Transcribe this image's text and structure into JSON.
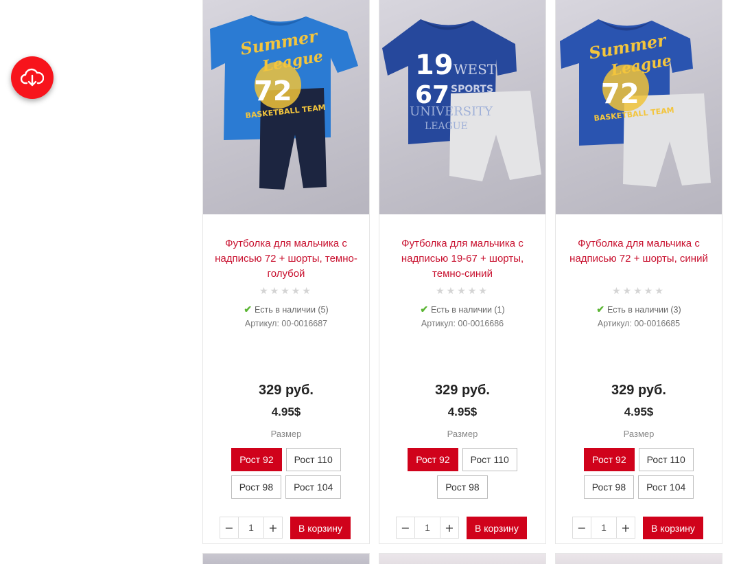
{
  "products": [
    {
      "title": "Футболка для мальчика с надписью 72 + шорты, темно-голубой",
      "stars": "★★★★★",
      "stock": "Есть в наличии (5)",
      "sku": "Артикул: 00-0016687",
      "price_rub": "329 руб.",
      "price_usd": "4.95$",
      "size_label": "Размер",
      "sizes": [
        "Рост 92",
        "Рост 110",
        "Рост 98",
        "Рост 104"
      ],
      "qty": "1",
      "cart_label": "В корзину",
      "shirt_color": "#2b7bd3",
      "shorts_color": "#1c2540",
      "print_text": [
        "Summer",
        "League",
        "72",
        "BASKETBALL TEAM"
      ]
    },
    {
      "title": "Футболка для мальчика с надписью 19-67 + шорты, темно-синий",
      "stars": "★★★★★",
      "stock": "Есть в наличии (1)",
      "sku": "Артикул: 00-0016686",
      "price_rub": "329 руб.",
      "price_usd": "4.95$",
      "size_label": "Размер",
      "sizes": [
        "Рост 92",
        "Рост 110",
        "Рост 98"
      ],
      "qty": "1",
      "cart_label": "В корзину",
      "shirt_color": "#26489c",
      "shorts_color": "#e4e4e6",
      "print_text": [
        "19",
        "67",
        "WEST",
        "SPORTS",
        "UNIVERSITY",
        "LEAGUE"
      ]
    },
    {
      "title": "Футболка для мальчика с надписью 72 + шорты, синий",
      "stars": "★★★★★",
      "stock": "Есть в наличии (3)",
      "sku": "Артикул: 00-0016685",
      "price_rub": "329 руб.",
      "price_usd": "4.95$",
      "size_label": "Размер",
      "sizes": [
        "Рост 92",
        "Рост 110",
        "Рост 98",
        "Рост 104"
      ],
      "qty": "1",
      "cart_label": "В корзину",
      "shirt_color": "#2a54b0",
      "shorts_color": "#e2e2e4",
      "print_text": [
        "Summer",
        "League",
        "72",
        "BASKETBALL TEAM"
      ]
    }
  ],
  "colors": {
    "accent": "#d0021b",
    "title": "#c8102e",
    "stock_check": "#5bb534",
    "fab": "#f7141c"
  },
  "icons": {
    "fab": "cloud-download-icon",
    "stock": "check-icon",
    "minus": "minus-icon",
    "plus": "plus-icon"
  }
}
